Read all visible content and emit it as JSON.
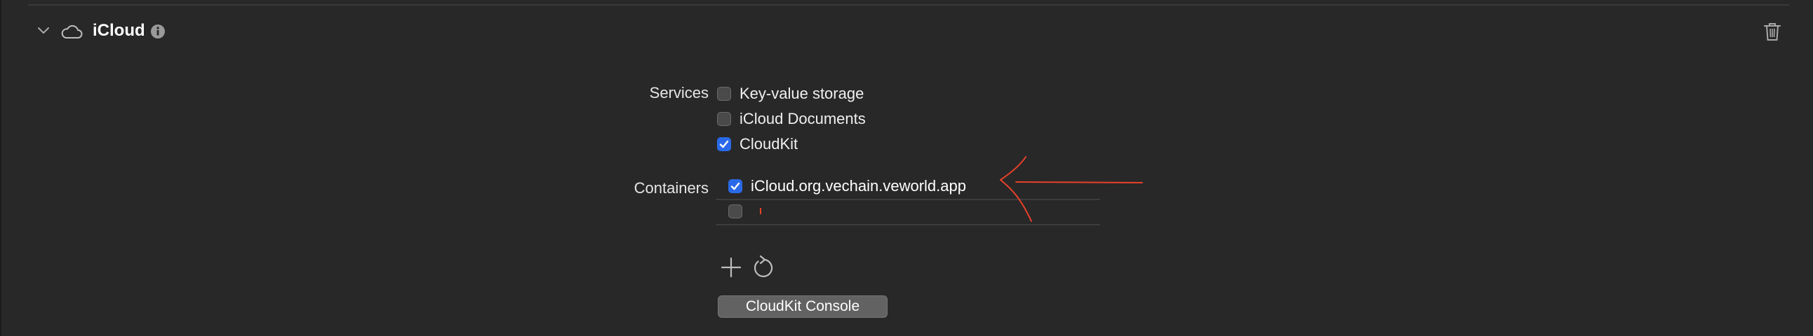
{
  "header": {
    "title": "iCloud",
    "icons": [
      "chevron-down-icon",
      "cloud-icon",
      "info-icon",
      "trash-icon"
    ]
  },
  "services": {
    "label": "Services",
    "items": [
      {
        "label": "Key-value storage",
        "checked": false
      },
      {
        "label": "iCloud Documents",
        "checked": false
      },
      {
        "label": "CloudKit",
        "checked": true
      }
    ]
  },
  "containers": {
    "label": "Containers",
    "items": [
      {
        "name": "iCloud.org.vechain.veworld.app",
        "checked": true
      },
      {
        "name": "",
        "checked": false
      }
    ]
  },
  "actions": {
    "add_icon": "plus-icon",
    "refresh_icon": "refresh-icon",
    "console_label": "CloudKit Console"
  },
  "colors": {
    "background": "#282828",
    "accent": "#2a6ae8",
    "annotation": "#e8402a"
  }
}
